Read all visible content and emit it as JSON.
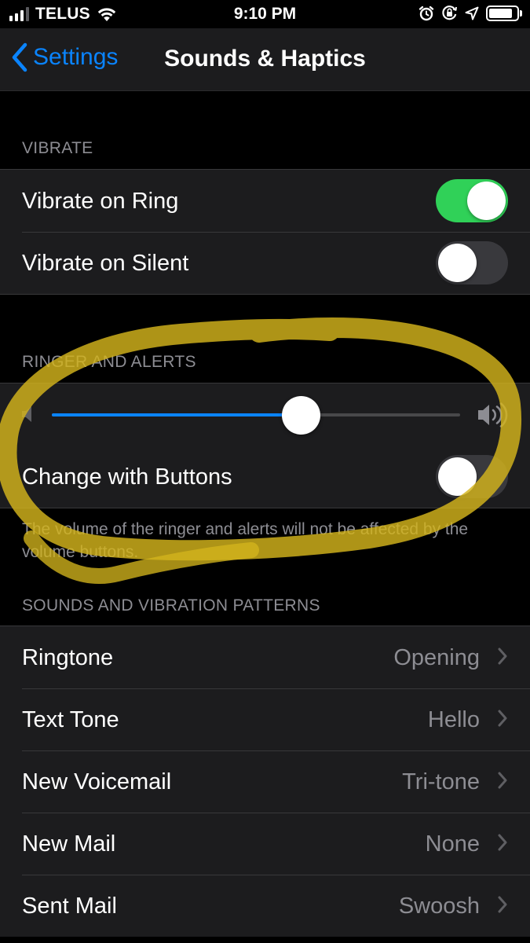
{
  "status_bar": {
    "carrier": "TELUS",
    "time": "9:10 PM",
    "signal_bars_filled": 3,
    "signal_bars_total": 4,
    "battery_level": 0.85,
    "icons": [
      "signal-icon",
      "wifi-icon",
      "alarm-icon",
      "orientation-lock-icon",
      "location-icon",
      "battery-icon"
    ]
  },
  "nav": {
    "back_label": "Settings",
    "title": "Sounds & Haptics"
  },
  "vibrate": {
    "header": "VIBRATE",
    "rows": [
      {
        "label": "Vibrate on Ring",
        "on": true
      },
      {
        "label": "Vibrate on Silent",
        "on": false
      }
    ]
  },
  "ringer": {
    "header": "RINGER AND ALERTS",
    "volume_level": 0.61,
    "change_with_buttons": {
      "label": "Change with Buttons",
      "on": false
    },
    "footer": "The volume of the ringer and alerts will not be affected by the volume buttons."
  },
  "patterns": {
    "header": "SOUNDS AND VIBRATION PATTERNS",
    "rows": [
      {
        "label": "Ringtone",
        "value": "Opening"
      },
      {
        "label": "Text Tone",
        "value": "Hello"
      },
      {
        "label": "New Voicemail",
        "value": "Tri-tone"
      },
      {
        "label": "New Mail",
        "value": "None"
      },
      {
        "label": "Sent Mail",
        "value": "Swoosh"
      }
    ]
  },
  "colors": {
    "accent": "#0a84ff",
    "toggle_on": "#30d158",
    "toggle_off": "#39393d",
    "highlight_marker": "#d4b51c"
  }
}
